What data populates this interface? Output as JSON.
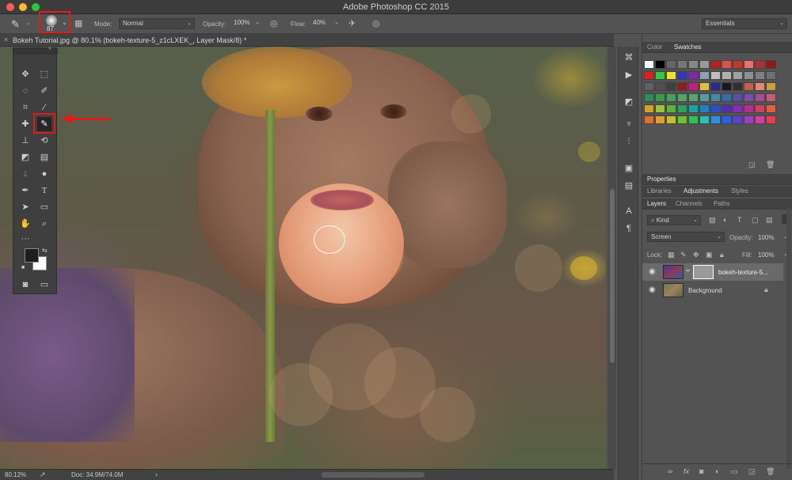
{
  "window": {
    "title": "Adobe Photoshop CC 2015",
    "traffic_colors": [
      "#fd5f57",
      "#fdbb2d",
      "#27c93f"
    ]
  },
  "options_bar": {
    "brush_size": "87",
    "mode_label": "Mode:",
    "mode_value": "Normal",
    "opacity_label": "Opacity:",
    "opacity_value": "100%",
    "flow_label": "Flow:",
    "flow_value": "40%",
    "workspace": "Essentials"
  },
  "document": {
    "tab_label": "Bokeh Tutorial.jpg @ 80.1% (bokeh-texture-5_z1cLXEK_, Layer Mask/8) *",
    "close_glyph": "×"
  },
  "tools": {
    "highlighted": "brush-tool",
    "icons": [
      "move-icon",
      "marquee-icon",
      "lasso-icon",
      "quick-select-icon",
      "crop-icon",
      "eyedropper-icon",
      "healing-icon",
      "brush-icon",
      "stamp-icon",
      "history-brush-icon",
      "eraser-icon",
      "gradient-icon",
      "blur-icon",
      "dodge-icon",
      "pen-icon",
      "type-icon",
      "path-select-icon",
      "shape-icon",
      "hand-icon",
      "zoom-icon",
      "more-icon",
      "color-swatch-icon",
      "quick-mask-icon",
      "screen-mode-icon"
    ],
    "foreground_color": "#1e1e1e",
    "background_color": "#ffffff"
  },
  "color_panel": {
    "tabs": [
      "Color",
      "Swatches"
    ],
    "active_tab": "Swatches",
    "swatches": [
      "#ffffff",
      "#000000",
      "#666666",
      "#777777",
      "#888888",
      "#999999",
      "#b22222",
      "#d9534f",
      "#c0392b",
      "#e57373",
      "#a93232",
      "#8b1a1a",
      "#e02020",
      "#2ecc40",
      "#f0e130",
      "#2b3ab5",
      "#7a2ba8",
      "#8fa0b5",
      "#c0c0c0",
      "#b0b0b0",
      "#a0a0a0",
      "#909090",
      "#808080",
      "#707070",
      "#606060",
      "#505050",
      "#404040",
      "#8a2020",
      "#c02080",
      "#e0c040",
      "#2a2a8a",
      "#1a1a1a",
      "#303030",
      "#c06050",
      "#e08a7a",
      "#c8a040",
      "#2e8b57",
      "#3a9a4a",
      "#4aa05a",
      "#5aa06a",
      "#60a070",
      "#5a9a9a",
      "#4a8aa0",
      "#3a6aa0",
      "#5a50a0",
      "#7a50a0",
      "#a05090",
      "#c06070",
      "#d0a030",
      "#a0c040",
      "#60b040",
      "#30a060",
      "#20a0a0",
      "#2080c0",
      "#3050c0",
      "#5030b0",
      "#8030b0",
      "#b03090",
      "#d04060",
      "#e06040",
      "#e07030",
      "#e0a030",
      "#c0c030",
      "#70c030",
      "#30c060",
      "#30c0b0",
      "#3090e0",
      "#3060e0",
      "#6040d0",
      "#a040c0",
      "#d040a0",
      "#e04050"
    ]
  },
  "properties_panel": {
    "title": "Properties",
    "tabs": [
      "Libraries",
      "Adjustments",
      "Styles"
    ],
    "active_tab": "Adjustments"
  },
  "layers_panel": {
    "tabs": [
      "Layers",
      "Channels",
      "Paths"
    ],
    "active_tab": "Layers",
    "filter_value": "Kind",
    "blend_mode": "Screen",
    "opacity_label": "Opacity:",
    "opacity_value": "100%",
    "lock_label": "Lock:",
    "fill_label": "Fill:",
    "fill_value": "100%",
    "layers": [
      {
        "name": "bokeh-texture-5...",
        "selected": true,
        "visible": true
      },
      {
        "name": "Background",
        "selected": false,
        "visible": true
      }
    ],
    "bottom_icons": [
      "link-icon",
      "fx-icon",
      "mask-icon",
      "adjustment-icon",
      "folder-icon",
      "new-layer-icon",
      "trash-icon"
    ]
  },
  "status": {
    "zoom": "80.12%",
    "doc": "Doc: 34.9M/74.0M"
  },
  "annotation_color": "#e31a1a"
}
